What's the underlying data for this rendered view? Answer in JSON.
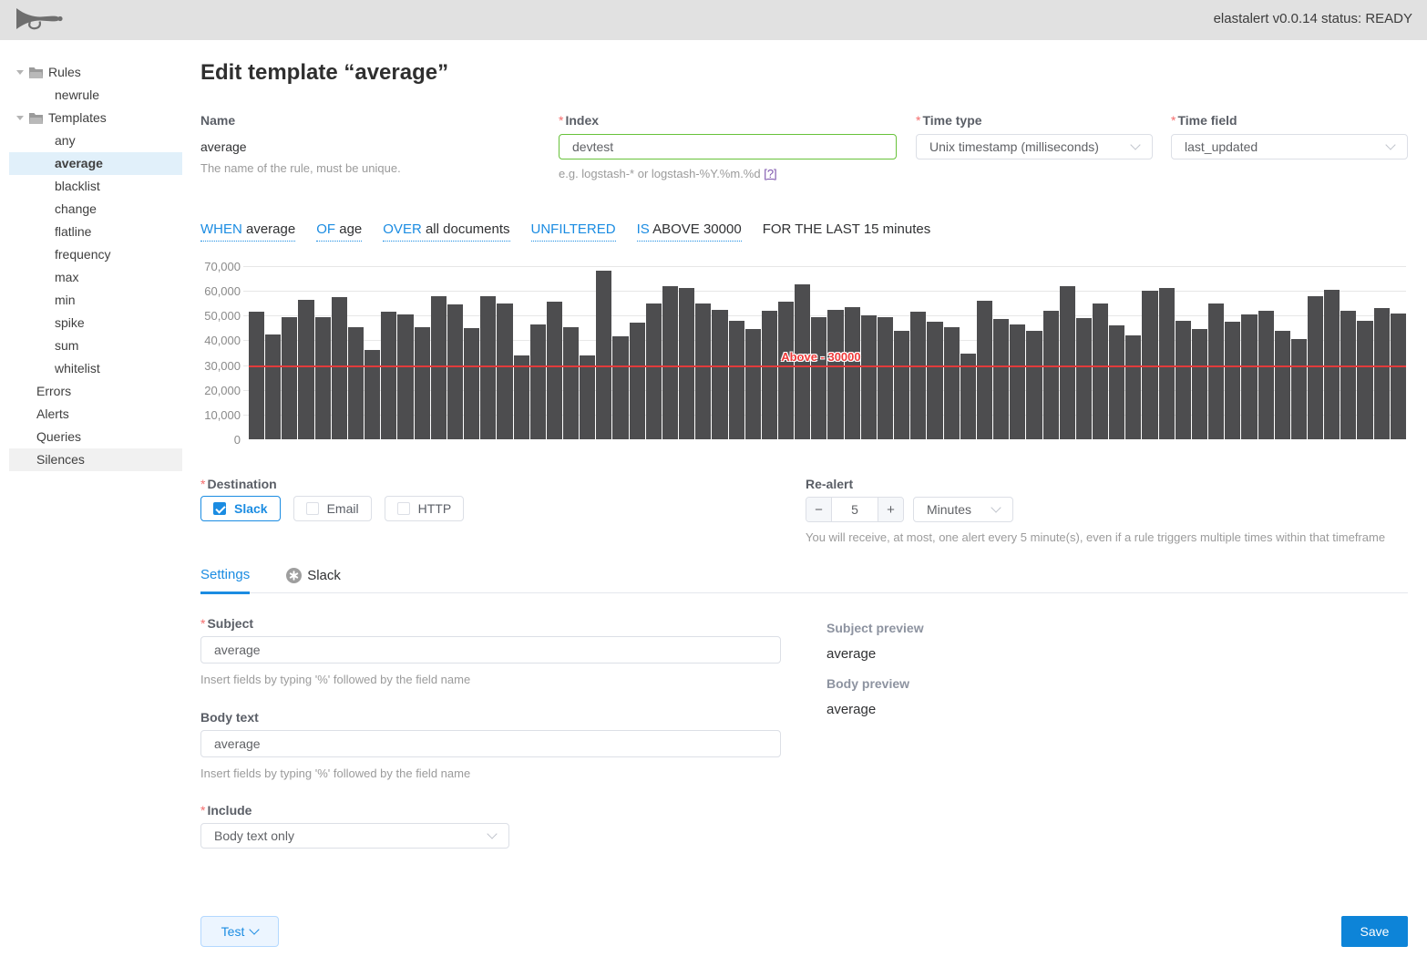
{
  "header": {
    "logo": "horn-icon",
    "status_text": "elastalert v0.0.14 status: READY"
  },
  "sidebar": {
    "items": [
      {
        "label": "Rules",
        "kind": "folder"
      },
      {
        "label": "newrule",
        "kind": "leaf"
      },
      {
        "label": "Templates",
        "kind": "folder"
      },
      {
        "label": "any",
        "kind": "leaf"
      },
      {
        "label": "average",
        "kind": "leaf",
        "state": "selected"
      },
      {
        "label": "blacklist",
        "kind": "leaf"
      },
      {
        "label": "change",
        "kind": "leaf"
      },
      {
        "label": "flatline",
        "kind": "leaf"
      },
      {
        "label": "frequency",
        "kind": "leaf"
      },
      {
        "label": "max",
        "kind": "leaf"
      },
      {
        "label": "min",
        "kind": "leaf"
      },
      {
        "label": "spike",
        "kind": "leaf"
      },
      {
        "label": "sum",
        "kind": "leaf"
      },
      {
        "label": "whitelist",
        "kind": "leaf"
      },
      {
        "label": "Errors",
        "kind": "root"
      },
      {
        "label": "Alerts",
        "kind": "root"
      },
      {
        "label": "Queries",
        "kind": "root"
      },
      {
        "label": "Silences",
        "kind": "root",
        "state": "hover"
      }
    ]
  },
  "page_title": "Edit template “average”",
  "form": {
    "name": {
      "label": "Name",
      "value": "average",
      "help": "The name of the rule, must be unique."
    },
    "index": {
      "label": "Index",
      "value": "devtest",
      "help": "e.g. logstash-* or logstash-%Y.%m.%d",
      "help_link": "[?]"
    },
    "time_type": {
      "label": "Time type",
      "value": "Unix timestamp (milliseconds)"
    },
    "time_field": {
      "label": "Time field",
      "value": "last_updated"
    }
  },
  "query": {
    "tokens": [
      {
        "blue": "WHEN",
        "plain": "average",
        "underline": true
      },
      {
        "blue": "OF",
        "plain": "age",
        "underline": true
      },
      {
        "blue": "OVER",
        "plain": "all documents",
        "underline": true
      },
      {
        "blue": "UNFILTERED",
        "plain": "",
        "underline": true
      },
      {
        "blue": "IS",
        "plain": "ABOVE 30000",
        "underline": true
      },
      {
        "blue": "",
        "plain": "FOR THE LAST 15 minutes",
        "underline": false
      }
    ]
  },
  "chart_data": {
    "type": "bar",
    "title": "",
    "ylim": [
      0,
      70000
    ],
    "yticks": [
      "70,000",
      "60,000",
      "50,000",
      "40,000",
      "30,000",
      "20,000",
      "10,000",
      "0"
    ],
    "grid": true,
    "bar_color": "#4d4d4f",
    "threshold": 30000,
    "threshold_label": "Above - 30000",
    "threshold_color": "#e23b3b",
    "values": [
      51500,
      42500,
      49500,
      56500,
      49500,
      57500,
      45500,
      36000,
      51500,
      50500,
      45500,
      58000,
      54500,
      45000,
      58000,
      55000,
      34000,
      46500,
      55500,
      45500,
      34000,
      68000,
      41500,
      47000,
      55000,
      62000,
      61000,
      55000,
      52500,
      48000,
      44500,
      52000,
      55500,
      62500,
      49500,
      52500,
      53500,
      50000,
      49500,
      44000,
      51500,
      47500,
      45500,
      34500,
      56000,
      48500,
      46500,
      44000,
      52000,
      62000,
      49000,
      55000,
      46000,
      42000,
      60000,
      61000,
      48000,
      44500,
      55000,
      47500,
      50500,
      52000,
      44000,
      40500,
      58000,
      60500,
      52000,
      48000,
      53000,
      51000
    ]
  },
  "destination": {
    "label": "Destination",
    "options": [
      {
        "label": "Slack",
        "checked": true
      },
      {
        "label": "Email",
        "checked": false
      },
      {
        "label": "HTTP",
        "checked": false
      }
    ]
  },
  "realert": {
    "label": "Re-alert",
    "minus": "−",
    "value": "5",
    "plus": "+",
    "unit": "Minutes",
    "help": "You will receive, at most, one alert every 5 minute(s), even if a rule triggers multiple times within that timeframe"
  },
  "tabs": {
    "items": [
      {
        "label": "Settings",
        "active": true
      },
      {
        "label": "Slack",
        "icon": "slack-icon"
      }
    ]
  },
  "settings": {
    "subject": {
      "label": "Subject",
      "value": "average",
      "help": "Insert fields by typing '%' followed by the field name"
    },
    "body": {
      "label": "Body text",
      "value": "average",
      "help": "Insert fields by typing '%' followed by the field name"
    },
    "include": {
      "label": "Include",
      "value": "Body text only"
    }
  },
  "preview": {
    "subject_label": "Subject preview",
    "subject_value": "average",
    "body_label": "Body preview",
    "body_value": "average"
  },
  "footer": {
    "test_label": "Test",
    "save_label": "Save"
  },
  "colors": {
    "accent": "#1b8ce2",
    "save_button": "#0d84d8",
    "valid_border": "#67c23a",
    "bar": "#4d4d4f",
    "threshold_line": "#e23b3b",
    "selected_row_bg": "#e1f0fa",
    "header_bg": "#e1e1e1"
  }
}
